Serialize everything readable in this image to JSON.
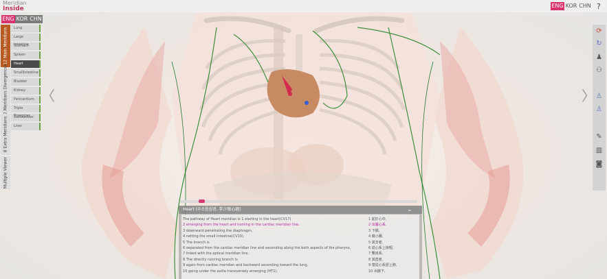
{
  "app": {
    "logo_top": "Meridian",
    "logo_bottom": "Inside"
  },
  "languages_left": [
    {
      "label": "ENG",
      "active": true
    },
    {
      "label": "KOR",
      "active": false
    },
    {
      "label": "CHN",
      "active": false
    }
  ],
  "languages_right": [
    {
      "label": "ENG",
      "active": true
    },
    {
      "label": "KOR",
      "active": false
    },
    {
      "label": "CHN",
      "active": false
    }
  ],
  "help_label": "?",
  "vertical_tabs": [
    {
      "label": "12 Main Meridians",
      "active": true
    },
    {
      "label": "12 Meridians Divergences",
      "active": false
    },
    {
      "label": "8 Extra Meridians",
      "active": false
    },
    {
      "label": "Multiple Viewer",
      "active": false
    }
  ],
  "meridians": [
    {
      "label": "Lung",
      "active": false
    },
    {
      "label": "Large Intestine",
      "active": false
    },
    {
      "label": "Stomach",
      "active": false
    },
    {
      "label": "Spleen",
      "active": false
    },
    {
      "label": "Heart",
      "active": true
    },
    {
      "label": "SmallIntestine",
      "active": false
    },
    {
      "label": "Bladder",
      "active": false
    },
    {
      "label": "Kidney",
      "active": false
    },
    {
      "label": "Pericardium",
      "active": false
    },
    {
      "label": "Triple Energizer",
      "active": false
    },
    {
      "label": "Gallbladder",
      "active": false
    },
    {
      "label": "Liver",
      "active": false
    }
  ],
  "nav": {
    "left_arrow": "〈",
    "right_arrow": "〉"
  },
  "tools": [
    {
      "icon": "rotate-body-icon"
    },
    {
      "icon": "rotate-head-icon"
    },
    {
      "icon": "torso-icon"
    },
    {
      "icon": "figure-pair-icon"
    },
    {
      "icon": "standing-figure-icon"
    },
    {
      "icon": "standing-figure-alt-icon"
    },
    {
      "icon": "pencil-icon"
    },
    {
      "icon": "trash-icon"
    },
    {
      "icon": "camera-icon"
    }
  ],
  "info_panel": {
    "title": "Heart (수소음심경, 手少陰心經)",
    "collapse": "⌄",
    "lines": [
      {
        "text": "The pathway of Heart meridian is 1 starting in the heart(CV17)",
        "hl": false
      },
      {
        "text": "2 emerging from the heart and homing in the cardiac meridian line,",
        "hl": true
      },
      {
        "text": "3 downward penetrating the diaphragm,",
        "hl": false
      },
      {
        "text": "4 netting the small intestine(CV10).",
        "hl": false
      },
      {
        "text": "5 The branch is",
        "hl": false
      },
      {
        "text": "6 separated from the cardiac meridian line and ascending along the both aspects of the pharynx,",
        "hl": false
      },
      {
        "text": "7 linked with the optical meridian line.",
        "hl": false
      },
      {
        "text": "8 The directly running branch is",
        "hl": false
      },
      {
        "text": "9 again from cardiac meridian and backward ascending toward the lung,",
        "hl": false
      },
      {
        "text": "10 going under the axilla transversely emerging (HT1).",
        "hl": false
      }
    ],
    "chinese": [
      {
        "text": "1 起於心中,",
        "hl": false
      },
      {
        "text": "2 出屬心系,",
        "hl": true
      },
      {
        "text": "3 下膈,",
        "hl": false
      },
      {
        "text": "4 絡小腸,",
        "hl": false
      },
      {
        "text": "5 其支者,",
        "hl": false
      },
      {
        "text": "6 從心系上挾咽,",
        "hl": false
      },
      {
        "text": "7 繫目系,",
        "hl": false
      },
      {
        "text": "8 其直者,",
        "hl": false
      },
      {
        "text": "9 復從心系卻上肺,",
        "hl": false
      },
      {
        "text": "10 出腋下,",
        "hl": false
      }
    ]
  },
  "timeline": {
    "position": 0.08
  }
}
